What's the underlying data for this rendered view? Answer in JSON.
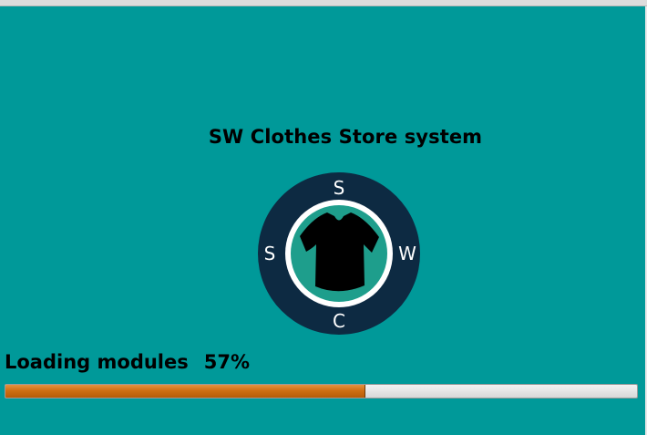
{
  "window": {
    "title": "SW Clothes Store system"
  },
  "logo": {
    "icon": "shirt-icon",
    "letters": {
      "top": "S",
      "left": "S",
      "right": "W",
      "bottom": "C"
    },
    "colors": {
      "outer_ring": "#0d2a42",
      "inner_ring": "#ffffff",
      "inner_disc": "#1e9e8c",
      "shirt": "#000000"
    }
  },
  "loading": {
    "label": "Loading modules",
    "percent_text": "57%",
    "progress": 0.57
  },
  "colors": {
    "background": "#009999",
    "progress_fill": "#cf6f13"
  }
}
